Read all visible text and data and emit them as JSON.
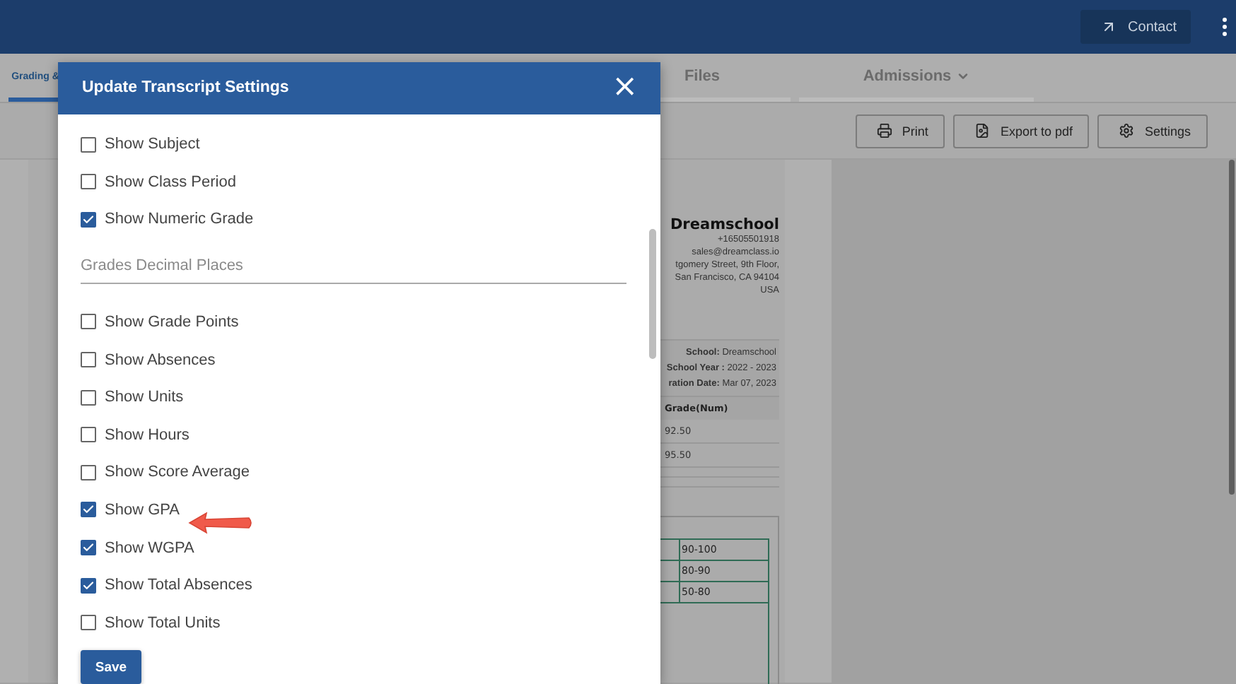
{
  "header": {
    "contact_button": "Contact"
  },
  "tabs": [
    {
      "label": "Grading &",
      "selected": true,
      "dropdown": false
    },
    {
      "label": "Files",
      "selected": false,
      "dropdown": false
    },
    {
      "label": "Admissions",
      "selected": false,
      "dropdown": true
    }
  ],
  "toolbar": [
    {
      "kind": "print",
      "label": "Print"
    },
    {
      "kind": "pdf",
      "label": "Export to pdf"
    },
    {
      "kind": "settings",
      "label": "Settings"
    }
  ],
  "document": {
    "school_name": "Dreamschool",
    "contact_lines": [
      "+16505501918",
      "sales@dreamclass.io",
      "tgomery Street, 9th Floor,",
      "San Francisco, CA 94104",
      "USA"
    ],
    "info_lines": [
      "**School:** Dreamschool",
      "**School Year :** 2022 - 2023",
      "**ration Date:** Mar 07, 2023"
    ],
    "grades_column": {
      "heading": "Grade(Num)",
      "values": [
        "92.50",
        "95.50"
      ]
    },
    "scale_rows": [
      "90-100",
      "80-90",
      "50-80"
    ]
  },
  "modal": {
    "title": "Update Transcript Settings",
    "close": "×",
    "save_button": "Save",
    "items": [
      {
        "kind": "checkbox",
        "label": "Show Subject",
        "checked": false
      },
      {
        "kind": "checkbox",
        "label": "Show Class Period",
        "checked": false
      },
      {
        "kind": "checkbox",
        "label": "Show Numeric Grade",
        "checked": true
      },
      {
        "kind": "field",
        "placeholder": "Grades Decimal Places"
      },
      {
        "kind": "checkbox",
        "label": "Show Grade Points",
        "checked": false
      },
      {
        "kind": "checkbox",
        "label": "Show Absences",
        "checked": false
      },
      {
        "kind": "checkbox",
        "label": "Show Units",
        "checked": false
      },
      {
        "kind": "checkbox",
        "label": "Show Hours",
        "checked": false
      },
      {
        "kind": "checkbox",
        "label": "Show Score Average",
        "checked": false
      },
      {
        "kind": "checkbox",
        "label": "Show GPA",
        "checked": true
      },
      {
        "kind": "checkbox",
        "label": "Show WGPA",
        "checked": true
      },
      {
        "kind": "checkbox",
        "label": "Show Total Absences",
        "checked": true
      },
      {
        "kind": "checkbox",
        "label": "Show Total Units",
        "checked": false
      }
    ]
  }
}
